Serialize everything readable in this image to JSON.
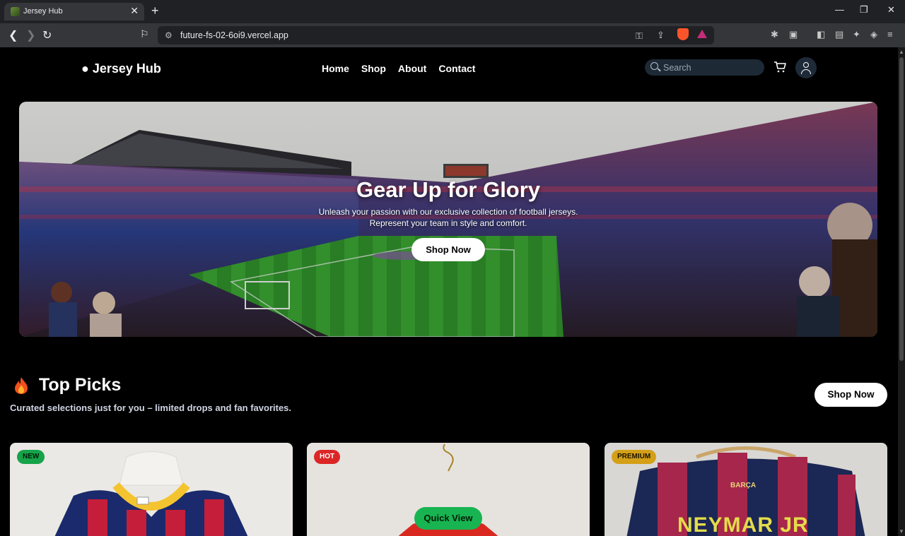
{
  "browser": {
    "tab_title": "Jersey Hub",
    "tab_close": "✕",
    "new_tab": "+",
    "url": "future-fs-02-6oi9.vercel.app",
    "window_controls": [
      "—",
      "❐",
      "✕"
    ]
  },
  "header": {
    "brand": "● Jersey Hub",
    "nav": [
      "Home",
      "Shop",
      "About",
      "Contact"
    ],
    "search_placeholder": "Search"
  },
  "hero": {
    "title": "Gear Up for Glory",
    "subtitle_line1": "Unleash your passion with our exclusive collection of football jerseys.",
    "subtitle_line2": "Represent your team in style and comfort.",
    "button": "Shop Now"
  },
  "top_picks": {
    "title": "Top Picks",
    "subtitle": "Curated selections just for you – limited drops and fan favorites.",
    "button": "Shop Now",
    "cards": [
      {
        "badge": "NEW",
        "badge_color": "#16a34a"
      },
      {
        "badge": "HOT",
        "badge_color": "#dc2626",
        "quick_view": "Quick View"
      },
      {
        "badge": "PREMIUM",
        "badge_color": "#d4a017",
        "jersey_text_top": "BARÇA",
        "jersey_text_name": "NEYMAR JR"
      }
    ]
  },
  "colors": {
    "accent_green": "#18b452",
    "page_bg": "#000000",
    "search_bg": "#1d2a36"
  }
}
